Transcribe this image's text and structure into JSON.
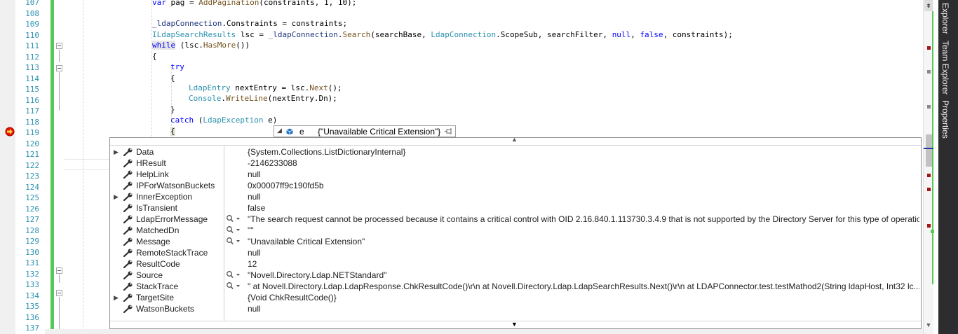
{
  "editor": {
    "line_numbers": [
      "107",
      "108",
      "109",
      "110",
      "111",
      "112",
      "113",
      "114",
      "115",
      "116",
      "117",
      "118",
      "119",
      "120",
      "121",
      "122",
      "123",
      "124",
      "125",
      "126",
      "127",
      "128",
      "129",
      "130",
      "131",
      "132",
      "133",
      "134",
      "135",
      "136",
      "137"
    ],
    "code": {
      "l107_a": "var",
      "l107_b": " pag = ",
      "l107_c": "AddPagination",
      "l107_d": "(constraints, 1, 10);",
      "l109_a": "_ldapConnection",
      "l109_b": ".Constraints = constraints;",
      "l110_a": "ILdapSearchResults",
      "l110_b": " lsc = ",
      "l110_c": "_ldapConnection",
      "l110_d": ".",
      "l110_e": "Search",
      "l110_f": "(searchBase, ",
      "l110_g": "LdapConnection",
      "l110_h": ".ScopeSub, searchFilter, ",
      "l110_i": "null",
      "l110_j": ", ",
      "l110_k": "false",
      "l110_l": ", constraints);",
      "l111_a": "while",
      "l111_b": " (lsc.",
      "l111_c": "HasMore",
      "l111_d": "())",
      "l112": "{",
      "l113": "try",
      "l114": "{",
      "l115_a": "LdapEntry",
      "l115_b": " nextEntry = lsc.",
      "l115_c": "Next",
      "l115_d": "();",
      "l116_a": "Console",
      "l116_b": ".",
      "l116_c": "WriteLine",
      "l116_d": "(nextEntry.Dn);",
      "l117": "}",
      "l118_a": "catch",
      "l118_b": " (",
      "l118_c": "LdapException",
      "l118_d": " e)",
      "l119": "{"
    }
  },
  "datatip": {
    "header": {
      "var_name": "e",
      "value": "{\"Unavailable Critical Extension\"}"
    },
    "rows": [
      {
        "name": "Data",
        "value": "{System.Collections.ListDictionaryInternal}",
        "expandable": true,
        "magnifier": false
      },
      {
        "name": "HResult",
        "value": "-2146233088",
        "expandable": false,
        "magnifier": false
      },
      {
        "name": "HelpLink",
        "value": "null",
        "expandable": false,
        "magnifier": false
      },
      {
        "name": "IPForWatsonBuckets",
        "value": "0x00007ff9c190fd5b",
        "expandable": false,
        "magnifier": false
      },
      {
        "name": "InnerException",
        "value": "null",
        "expandable": true,
        "magnifier": false
      },
      {
        "name": "IsTransient",
        "value": "false",
        "expandable": false,
        "magnifier": false
      },
      {
        "name": "LdapErrorMessage",
        "value": "\"The search request cannot be processed because it contains a critical control with OID 2.16.840.1.113730.3.4.9 that is not supported by the Directory Server for this type of operation\"",
        "expandable": false,
        "magnifier": true
      },
      {
        "name": "MatchedDn",
        "value": "\"\"",
        "expandable": false,
        "magnifier": true
      },
      {
        "name": "Message",
        "value": "\"Unavailable Critical Extension\"",
        "expandable": false,
        "magnifier": true
      },
      {
        "name": "RemoteStackTrace",
        "value": "null",
        "expandable": false,
        "magnifier": false
      },
      {
        "name": "ResultCode",
        "value": "12",
        "expandable": false,
        "magnifier": false
      },
      {
        "name": "Source",
        "value": "\"Novell.Directory.Ldap.NETStandard\"",
        "expandable": false,
        "magnifier": true
      },
      {
        "name": "StackTrace",
        "value": "\"   at Novell.Directory.Ldap.LdapResponse.ChkResultCode()\\r\\n   at Novell.Directory.Ldap.LdapSearchResults.Next()\\r\\n   at LDAPConnector.test.testMathod2(String ldapHost, Int32 lc...",
        "expandable": false,
        "magnifier": true
      },
      {
        "name": "TargetSite",
        "value": "{Void ChkResultCode()}",
        "expandable": true,
        "magnifier": false
      },
      {
        "name": "WatsonBuckets",
        "value": "null",
        "expandable": false,
        "magnifier": false
      }
    ]
  },
  "side_tabs": [
    "Explorer",
    "Team Explorer",
    "Properties"
  ],
  "colors": {
    "green_bar": "#57c75a",
    "side_panel": "#2d2d30",
    "marker_red": "#a31515"
  }
}
